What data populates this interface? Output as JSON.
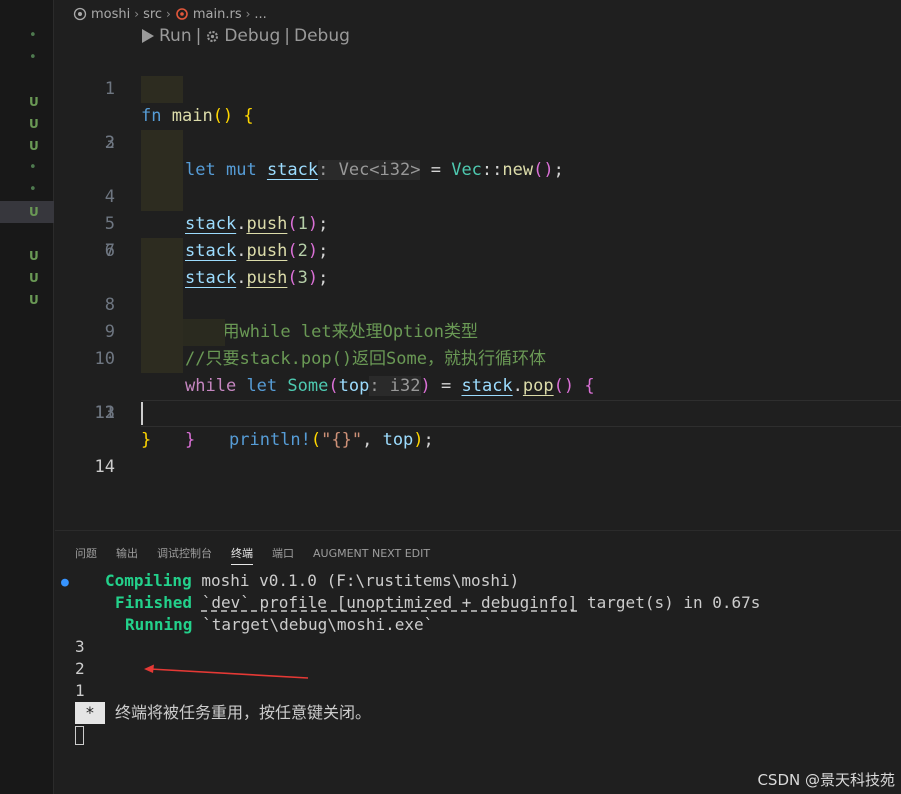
{
  "breadcrumb": [
    "moshi",
    "src",
    "main.rs",
    "..."
  ],
  "codelens": {
    "run": "Run",
    "sep": "|",
    "debug1": "Debug",
    "debug2": "Debug"
  },
  "lines": [
    {
      "n": "1"
    },
    {
      "n": "2"
    },
    {
      "n": "3"
    },
    {
      "n": "4"
    },
    {
      "n": "5"
    },
    {
      "n": "6"
    },
    {
      "n": "7"
    },
    {
      "n": "8"
    },
    {
      "n": "9"
    },
    {
      "n": "10"
    },
    {
      "n": "11"
    },
    {
      "n": "12"
    },
    {
      "n": "13"
    },
    {
      "n": "14"
    }
  ],
  "code": {
    "l1": {
      "fn": "fn",
      "main": "main",
      "open": "()",
      "brace": "{"
    },
    "l2": {
      "let": "let",
      "mut": "mut",
      "var": "stack",
      "hint": ": Vec<i32>",
      "eq": " = ",
      "ty": "Vec",
      "sep": "::",
      "new": "new",
      "paren": "()",
      "semi": ";"
    },
    "push1": {
      "var": "stack",
      "dot": ".",
      "fn": "push",
      "open": "(",
      "num": "1",
      "close": ")",
      "semi": ";"
    },
    "push2": {
      "var": "stack",
      "dot": ".",
      "fn": "push",
      "open": "(",
      "num": "2",
      "close": ")",
      "semi": ";"
    },
    "push3": {
      "var": "stack",
      "dot": ".",
      "fn": "push",
      "open": "(",
      "num": "3",
      "close": ")",
      "semi": ";"
    },
    "c1": "//使用while let来处理Option类型",
    "c2": "//只要stack.pop()返回Some，就执行循环体",
    "l10": {
      "while": "while",
      "let": "let",
      "some": "Some",
      "open": "(",
      "top": "top",
      "hint": ": i32",
      "close": ")",
      "eq": " = ",
      "var": "stack",
      "dot": ".",
      "pop": "pop",
      "paren": "()",
      "brace": "{"
    },
    "l11": {
      "mac": "println!",
      "open": "(",
      "str": "\"{}\"",
      "comma": ", ",
      "top": "top",
      "close": ")",
      "semi": ";"
    },
    "l12": "}",
    "l13": "}"
  },
  "panel_tabs": [
    "问题",
    "输出",
    "调试控制台",
    "终端",
    "端口",
    "AUGMENT NEXT EDIT"
  ],
  "terminal": {
    "compiling_label": "Compiling",
    "compiling_text": " moshi v0.1.0 (F:\\rustitems\\moshi)",
    "finished_label": "Finished",
    "finished_pre": " ",
    "finished_ul": "`dev` profile [unoptimized + debuginfo]",
    "finished_post": " target(s) in 0.67s",
    "running_label": "Running",
    "running_text": " `target\\debug\\moshi.exe`",
    "out1": "3",
    "out2": "2",
    "out3": "1",
    "star": "*",
    "reuse": "终端将被任务重用，按任意键关闭。"
  },
  "scm_marks": [
    "•",
    "•",
    "U",
    "U",
    "U",
    "•",
    "•",
    "U",
    "U",
    "U",
    "U"
  ],
  "watermark": "CSDN @景天科技苑",
  "colors": {
    "background": "#1f1f1f",
    "green": "#23d18b",
    "arrow": "#e53935"
  }
}
